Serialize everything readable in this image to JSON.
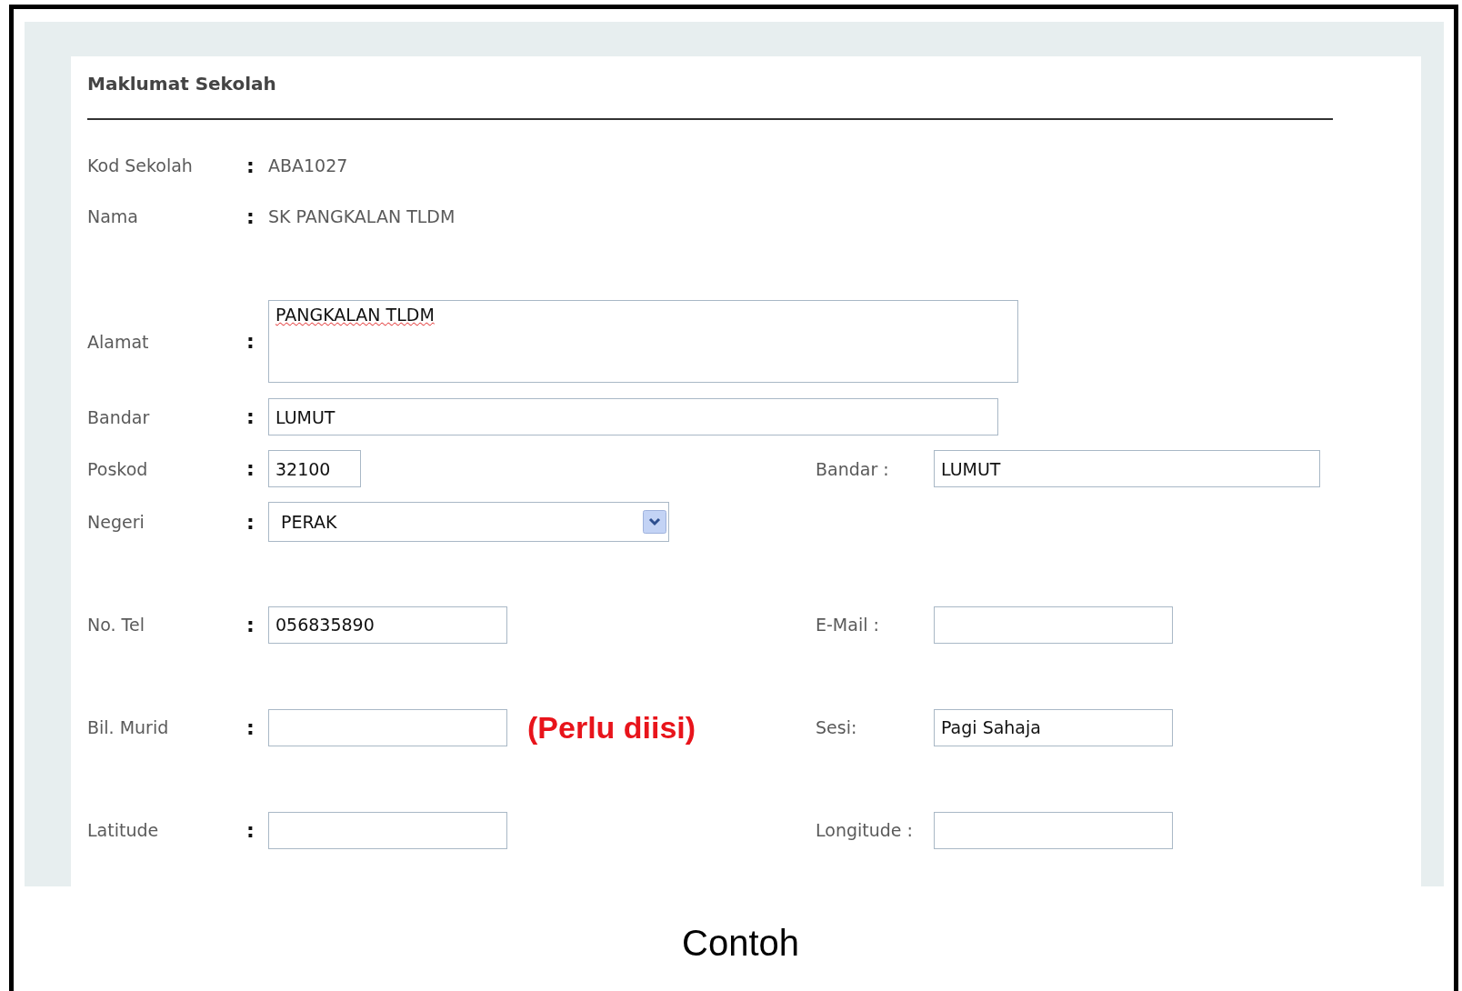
{
  "form": {
    "title": "Maklumat Sekolah",
    "rows": [
      {
        "kind": "text",
        "label": "Kod Sekolah",
        "colon": ":",
        "value": "ABA1027"
      },
      {
        "kind": "text",
        "label": "Nama",
        "colon": ":",
        "value": "SK PANGKALAN TLDM"
      },
      {
        "kind": "textarea",
        "label": "Alamat",
        "colon": ":",
        "value": "PANGKALAN TLDM",
        "misspelled": true
      },
      {
        "kind": "input",
        "label": "Bandar",
        "colon": ":",
        "value": "LUMUT"
      },
      {
        "kind": "input",
        "label": "Poskod",
        "colon": ":",
        "value": "32100",
        "side": {
          "label": "Bandar :",
          "value": "LUMUT"
        }
      },
      {
        "kind": "select",
        "label": "Negeri",
        "colon": ":",
        "value": "PERAK"
      },
      {
        "kind": "input",
        "label": "No. Tel",
        "colon": ":",
        "value": "056835890",
        "side": {
          "label": "E-Mail :"
        }
      },
      {
        "kind": "input",
        "label": "Bil. Murid",
        "colon": ":",
        "note": "(Perlu diisi)",
        "side": {
          "label": "Sesi:",
          "value": "Pagi Sahaja"
        }
      },
      {
        "kind": "input",
        "label": "Latitude",
        "colon": ":",
        "side": {
          "label": "Longitude :"
        }
      }
    ]
  },
  "caption": "Contoh"
}
